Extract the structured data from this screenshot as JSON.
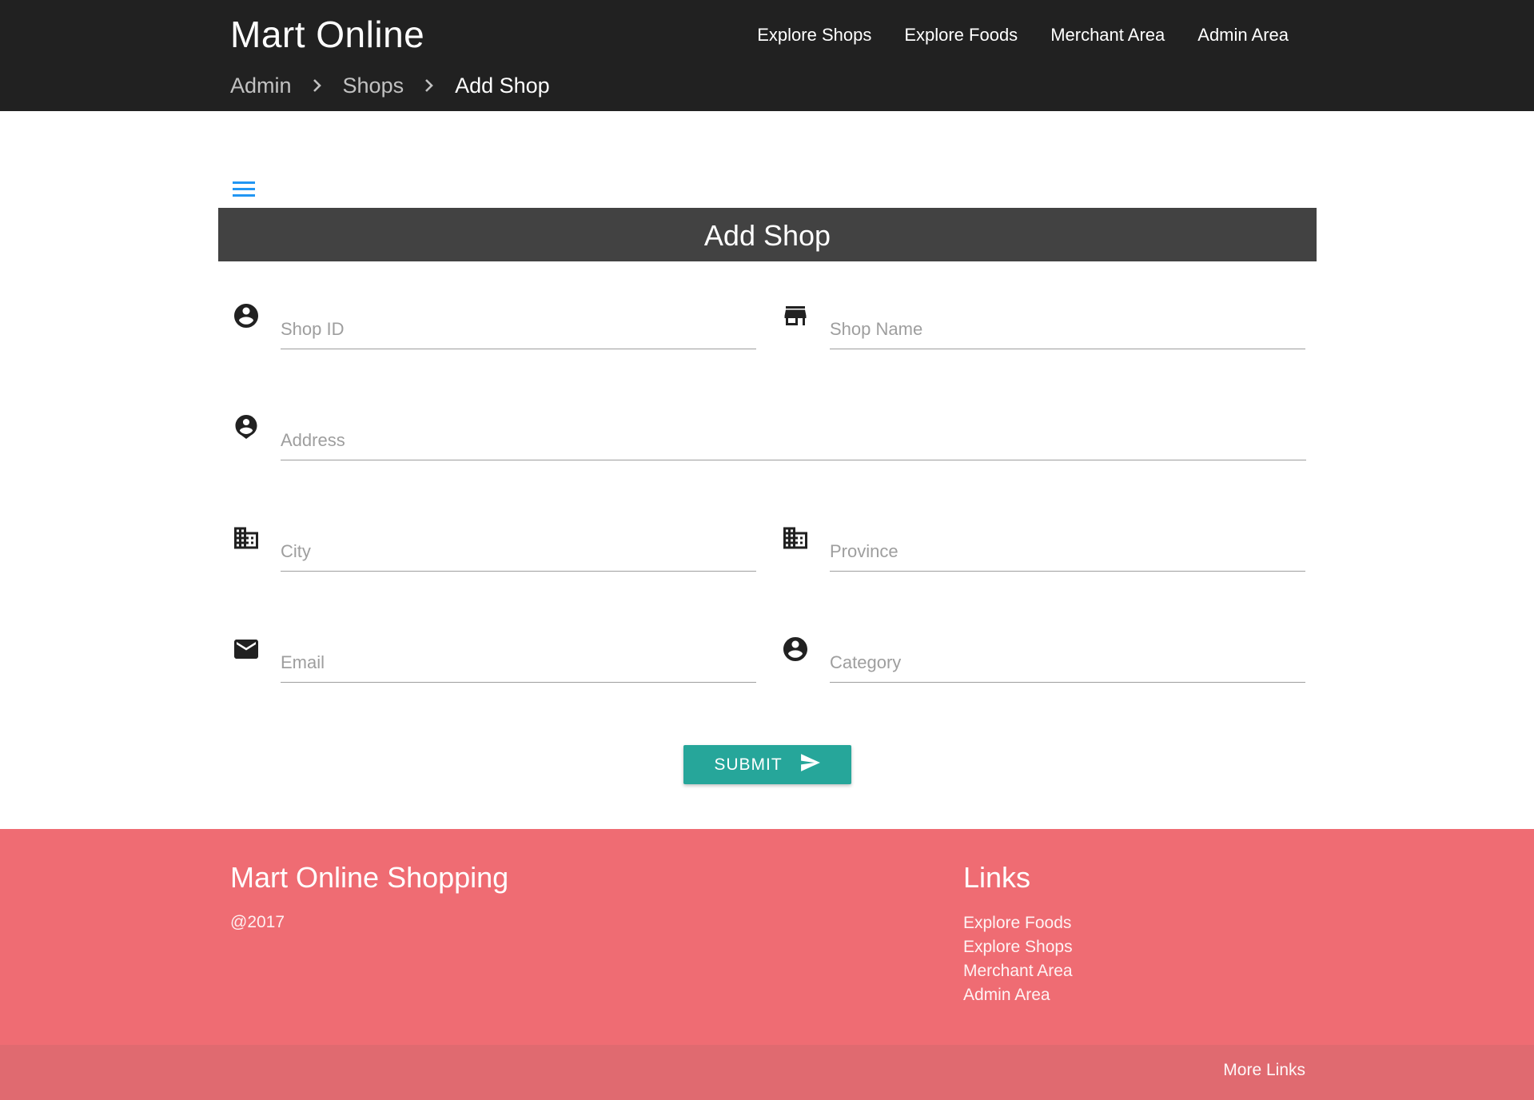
{
  "header": {
    "brand": "Mart Online",
    "nav": [
      {
        "label": "Explore Shops"
      },
      {
        "label": "Explore Foods"
      },
      {
        "label": "Merchant Area"
      },
      {
        "label": "Admin Area"
      }
    ],
    "breadcrumbs": [
      {
        "label": "Admin"
      },
      {
        "label": "Shops"
      },
      {
        "label": "Add Shop"
      }
    ]
  },
  "form": {
    "title": "Add Shop",
    "fields": {
      "shop_id": {
        "placeholder": "Shop ID",
        "value": "",
        "icon": "account-circle-icon"
      },
      "shop_name": {
        "placeholder": "Shop Name",
        "value": "",
        "icon": "store-icon"
      },
      "address": {
        "placeholder": "Address",
        "value": "",
        "icon": "person-pin-icon"
      },
      "city": {
        "placeholder": "City",
        "value": "",
        "icon": "business-icon"
      },
      "province": {
        "placeholder": "Province",
        "value": "",
        "icon": "business-icon"
      },
      "email": {
        "placeholder": "Email",
        "value": "",
        "icon": "email-icon"
      },
      "category": {
        "placeholder": "Category",
        "value": "",
        "icon": "account-circle-icon"
      }
    },
    "submit_label": "SUBMIT"
  },
  "footer": {
    "title": "Mart Online Shopping",
    "year": "@2017",
    "links_title": "Links",
    "links": [
      {
        "label": "Explore Foods"
      },
      {
        "label": "Explore Shops"
      },
      {
        "label": "Merchant Area"
      },
      {
        "label": "Admin Area"
      }
    ],
    "more_links": "More Links"
  },
  "colors": {
    "header_bg": "#212121",
    "title_bar_bg": "#424242",
    "accent": "#26a69a",
    "menu_icon": "#2196f3",
    "footer_bg": "#ef6c73",
    "footer_bottom_bg": "#e06a70"
  }
}
